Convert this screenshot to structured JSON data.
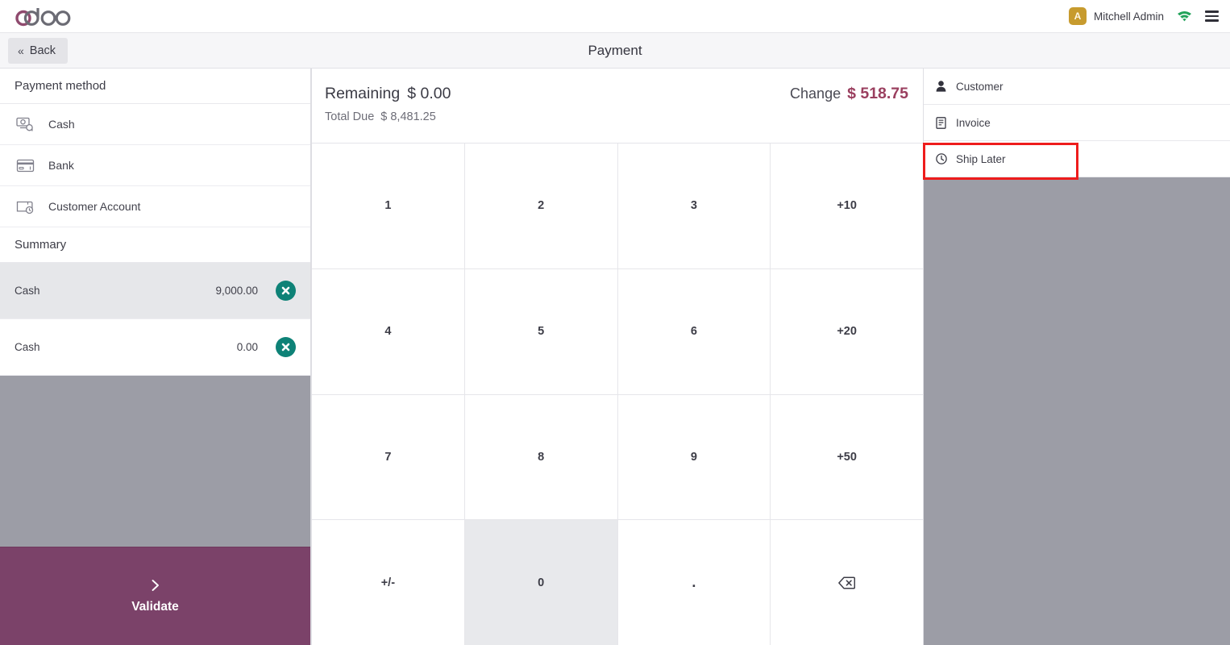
{
  "app": {
    "brand": "odoo",
    "screen_title": "Payment"
  },
  "topbar": {
    "avatar_initial": "A",
    "user_name": "Mitchell Admin",
    "wifi_icon": "wifi-icon",
    "menu_icon": "hamburger-menu-icon",
    "wifi_color": "#22a35a"
  },
  "subbar": {
    "back_label": "Back",
    "back_chevron": "«"
  },
  "left_pane": {
    "payment_method_header": "Payment method",
    "methods": [
      {
        "label": "Cash",
        "icon": "banknote-icon"
      },
      {
        "label": "Bank",
        "icon": "credit-card-icon"
      },
      {
        "label": "Customer Account",
        "icon": "wallet-clock-icon"
      }
    ],
    "summary_header": "Summary",
    "summary_lines": [
      {
        "name": "Cash",
        "amount": "9,000.00",
        "selected": true,
        "delete_icon": "close-circle-icon"
      },
      {
        "name": "Cash",
        "amount": "0.00",
        "selected": false,
        "delete_icon": "close-circle-icon"
      }
    ],
    "validate_label": "Validate",
    "validate_icon": "chevron-right-icon",
    "validate_color": "#7b4269"
  },
  "center_pane": {
    "remaining_label": "Remaining",
    "remaining_value": "$ 0.00",
    "total_due_label": "Total Due",
    "total_due_value": "$ 8,481.25",
    "change_label": "Change",
    "change_value": "$ 518.75",
    "change_color": "#9a3f5f",
    "numpad": [
      {
        "label": "1",
        "name": "numpad-key-1",
        "active": false
      },
      {
        "label": "2",
        "name": "numpad-key-2",
        "active": false
      },
      {
        "label": "3",
        "name": "numpad-key-3",
        "active": false
      },
      {
        "label": "+10",
        "name": "numpad-key-plus-10",
        "active": false
      },
      {
        "label": "4",
        "name": "numpad-key-4",
        "active": false
      },
      {
        "label": "5",
        "name": "numpad-key-5",
        "active": false
      },
      {
        "label": "6",
        "name": "numpad-key-6",
        "active": false
      },
      {
        "label": "+20",
        "name": "numpad-key-plus-20",
        "active": false
      },
      {
        "label": "7",
        "name": "numpad-key-7",
        "active": false
      },
      {
        "label": "8",
        "name": "numpad-key-8",
        "active": false
      },
      {
        "label": "9",
        "name": "numpad-key-9",
        "active": false
      },
      {
        "label": "+50",
        "name": "numpad-key-plus-50",
        "active": false
      },
      {
        "label": "+/-",
        "name": "numpad-key-sign-toggle",
        "active": false
      },
      {
        "label": "0",
        "name": "numpad-key-0",
        "active": true
      },
      {
        "label": ".",
        "name": "numpad-key-decimal",
        "active": false
      },
      {
        "label": "",
        "name": "numpad-key-backspace",
        "active": false,
        "icon": "backspace-icon"
      }
    ]
  },
  "right_pane": {
    "actions": [
      {
        "label": "Customer",
        "icon": "person-icon"
      },
      {
        "label": "Invoice",
        "icon": "document-icon"
      },
      {
        "label": "Ship Later",
        "icon": "clock-icon"
      }
    ]
  },
  "highlight": {
    "target": "Ship Later",
    "color": "#ee1c1c"
  }
}
